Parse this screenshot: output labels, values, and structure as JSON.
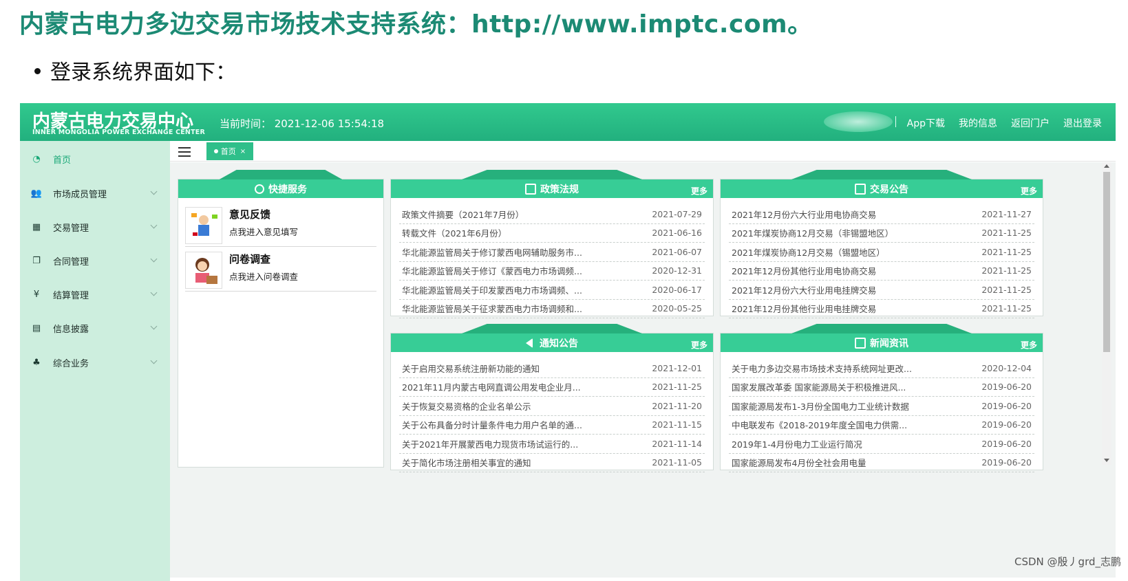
{
  "slide": {
    "title": "内蒙古电力多边交易市场技术支持系统：http://www.imptc.com。",
    "bullet": "登录系统界面如下："
  },
  "header": {
    "brand_cn": "内蒙古电力交易中心",
    "brand_en": "INNER MONGOLIA POWER EXCHANGE CENTER",
    "time_label": "当前时间：  2021-12-06 15:54:18",
    "links": [
      "App下载",
      "我的信息",
      "返回门户",
      "退出登录"
    ]
  },
  "sidebar": {
    "items": [
      {
        "label": "首页",
        "icon": "dashboard-icon",
        "glyph": "◔"
      },
      {
        "label": "市场成员管理",
        "icon": "users-icon",
        "glyph": "👥"
      },
      {
        "label": "交易管理",
        "icon": "grid-icon",
        "glyph": "▦"
      },
      {
        "label": "合同管理",
        "icon": "copy-icon",
        "glyph": "❐"
      },
      {
        "label": "结算管理",
        "icon": "yen-icon",
        "glyph": "¥"
      },
      {
        "label": "信息披露",
        "icon": "file-icon",
        "glyph": "▤"
      },
      {
        "label": "综合业务",
        "icon": "sitemap-icon",
        "glyph": "♣"
      }
    ]
  },
  "tabs": {
    "home_label": "首页",
    "close": "×"
  },
  "quick_service": {
    "title": "快捷服务",
    "items": [
      {
        "title": "意见反馈",
        "subtitle": "点我进入意见填写"
      },
      {
        "title": "问卷调查",
        "subtitle": "点我进入问卷调查"
      }
    ]
  },
  "policy": {
    "title": "政策法规",
    "more": "更多",
    "rows": [
      {
        "text": "政策文件摘要（2021年7月份）",
        "date": "2021-07-29"
      },
      {
        "text": "转载文件（2021年6月份）",
        "date": "2021-06-16"
      },
      {
        "text": "华北能源监管局关于修订蒙西电网辅助服务市...",
        "date": "2021-06-07"
      },
      {
        "text": "华北能源监管局关于修订《蒙西电力市场调频...",
        "date": "2020-12-31"
      },
      {
        "text": "华北能源监管局关于印发蒙西电力市场调频、...",
        "date": "2020-06-17"
      },
      {
        "text": "华北能源监管局关于征求蒙西电力市场调频和...",
        "date": "2020-05-25"
      }
    ]
  },
  "trade_notice": {
    "title": "交易公告",
    "more": "更多",
    "rows": [
      {
        "text": "2021年12月份六大行业用电协商交易",
        "date": "2021-11-27"
      },
      {
        "text": "2021年煤炭协商12月交易（非锡盟地区）",
        "date": "2021-11-25"
      },
      {
        "text": "2021年煤炭协商12月交易（锡盟地区）",
        "date": "2021-11-25"
      },
      {
        "text": "2021年12月份其他行业用电协商交易",
        "date": "2021-11-25"
      },
      {
        "text": "2021年12月份六大行业用电挂牌交易",
        "date": "2021-11-25"
      },
      {
        "text": "2021年12月份其他行业用电挂牌交易",
        "date": "2021-11-25"
      }
    ]
  },
  "announcement": {
    "title": "通知公告",
    "more": "更多",
    "rows": [
      {
        "text": "关于启用交易系统注册新功能的通知",
        "date": "2021-12-01"
      },
      {
        "text": "2021年11月内蒙古电网直调公用发电企业月...",
        "date": "2021-11-25"
      },
      {
        "text": "关于恢复交易资格的企业名单公示",
        "date": "2021-11-20"
      },
      {
        "text": "关于公布具备分时计量条件电力用户名单的通...",
        "date": "2021-11-15"
      },
      {
        "text": "关于2021年开展蒙西电力现货市场试运行的...",
        "date": "2021-11-14"
      },
      {
        "text": "关于简化市场注册相关事宜的通知",
        "date": "2021-11-05"
      }
    ]
  },
  "news": {
    "title": "新闻资讯",
    "more": "更多",
    "rows": [
      {
        "text": "关于电力多边交易市场技术支持系统网址更改...",
        "date": "2020-12-04"
      },
      {
        "text": "国家发展改革委 国家能源局关于积极推进风...",
        "date": "2019-06-20"
      },
      {
        "text": "国家能源局发布1-3月份全国电力工业统计数据",
        "date": "2019-06-20"
      },
      {
        "text": "中电联发布《2018-2019年度全国电力供需...",
        "date": "2019-06-20"
      },
      {
        "text": "2019年1-4月份电力工业运行简况",
        "date": "2019-06-20"
      },
      {
        "text": "国家能源局发布4月份全社会用电量",
        "date": "2019-06-20"
      }
    ]
  },
  "watermark": "CSDN @殷丿grd_志鹏",
  "colors": {
    "brand": "#22b07e",
    "panel_head": "#37cd96",
    "sidebar": "#cdeede",
    "title": "#1c8a74"
  }
}
